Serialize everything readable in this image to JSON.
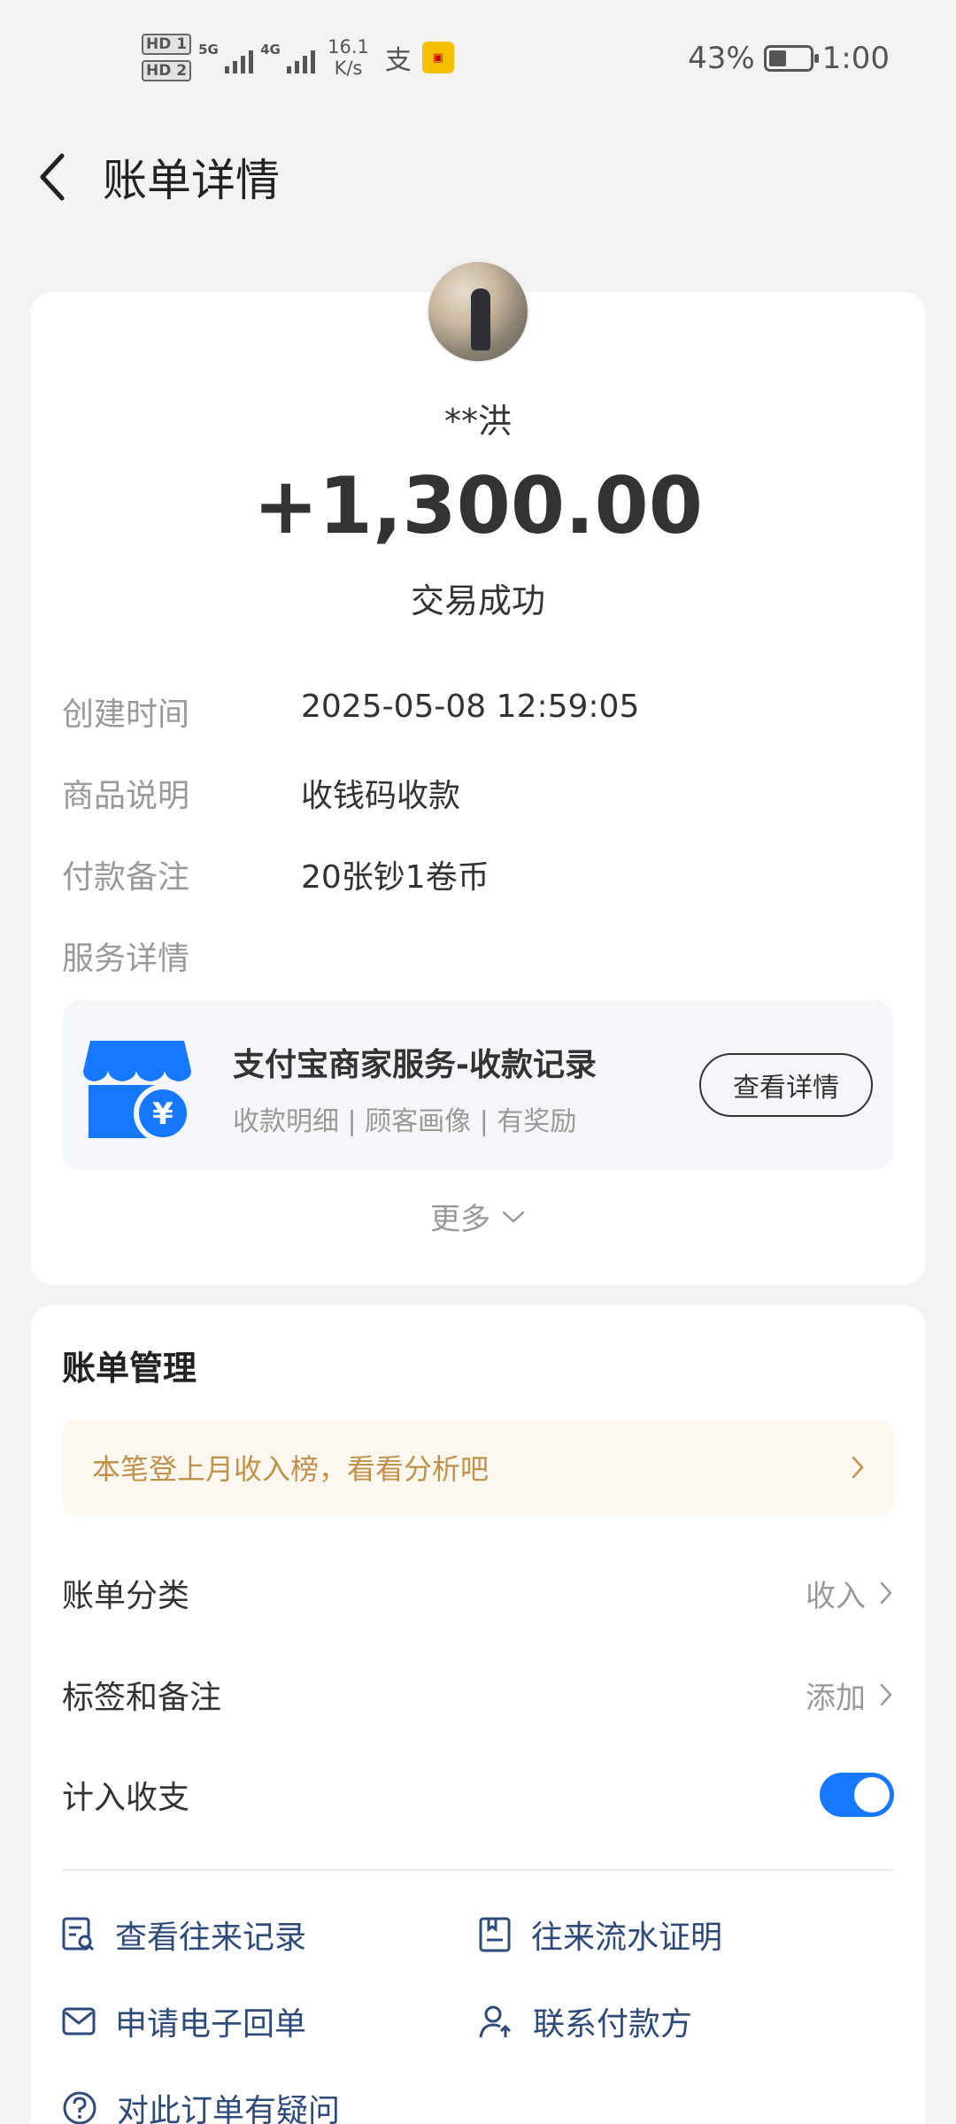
{
  "status_bar": {
    "hd1": "HD 1",
    "hd2": "HD 2",
    "net1": "5G",
    "net2": "4G",
    "speed_value": "16.1",
    "speed_unit": "K/s",
    "battery_percent": "43%",
    "battery_level": 0.43,
    "time": "1:00"
  },
  "header": {
    "title": "账单详情"
  },
  "transaction": {
    "payee": "**洪",
    "amount": "+1,300.00",
    "status": "交易成功",
    "details": [
      {
        "label": "创建时间",
        "value": "2025-05-08 12:59:05"
      },
      {
        "label": "商品说明",
        "value": "收钱码收款"
      },
      {
        "label": "付款备注",
        "value": "20张钞1卷币"
      },
      {
        "label": "服务详情",
        "value": ""
      }
    ],
    "service": {
      "title": "支付宝商家服务-收款记录",
      "subtitle": "收款明细 | 顾客画像 | 有奖励",
      "button": "查看详情"
    },
    "more": "更多"
  },
  "management": {
    "title": "账单管理",
    "banner": "本笔登上月收入榜，看看分析吧",
    "category": {
      "label": "账单分类",
      "value": "收入"
    },
    "tags": {
      "label": "标签和备注",
      "value": "添加"
    },
    "include": {
      "label": "计入收支",
      "enabled": true
    },
    "actions": [
      {
        "label": "查看往来记录",
        "icon": "records-icon"
      },
      {
        "label": "往来流水证明",
        "icon": "statement-icon"
      },
      {
        "label": "申请电子回单",
        "icon": "mail-icon"
      },
      {
        "label": "联系付款方",
        "icon": "contact-icon"
      },
      {
        "label": "对此订单有疑问",
        "icon": "question-icon"
      }
    ]
  },
  "colors": {
    "accent": "#1677ff",
    "banner_text": "#c0914a",
    "action_text": "#2e4a7a",
    "service_icon": "#1677ff"
  }
}
